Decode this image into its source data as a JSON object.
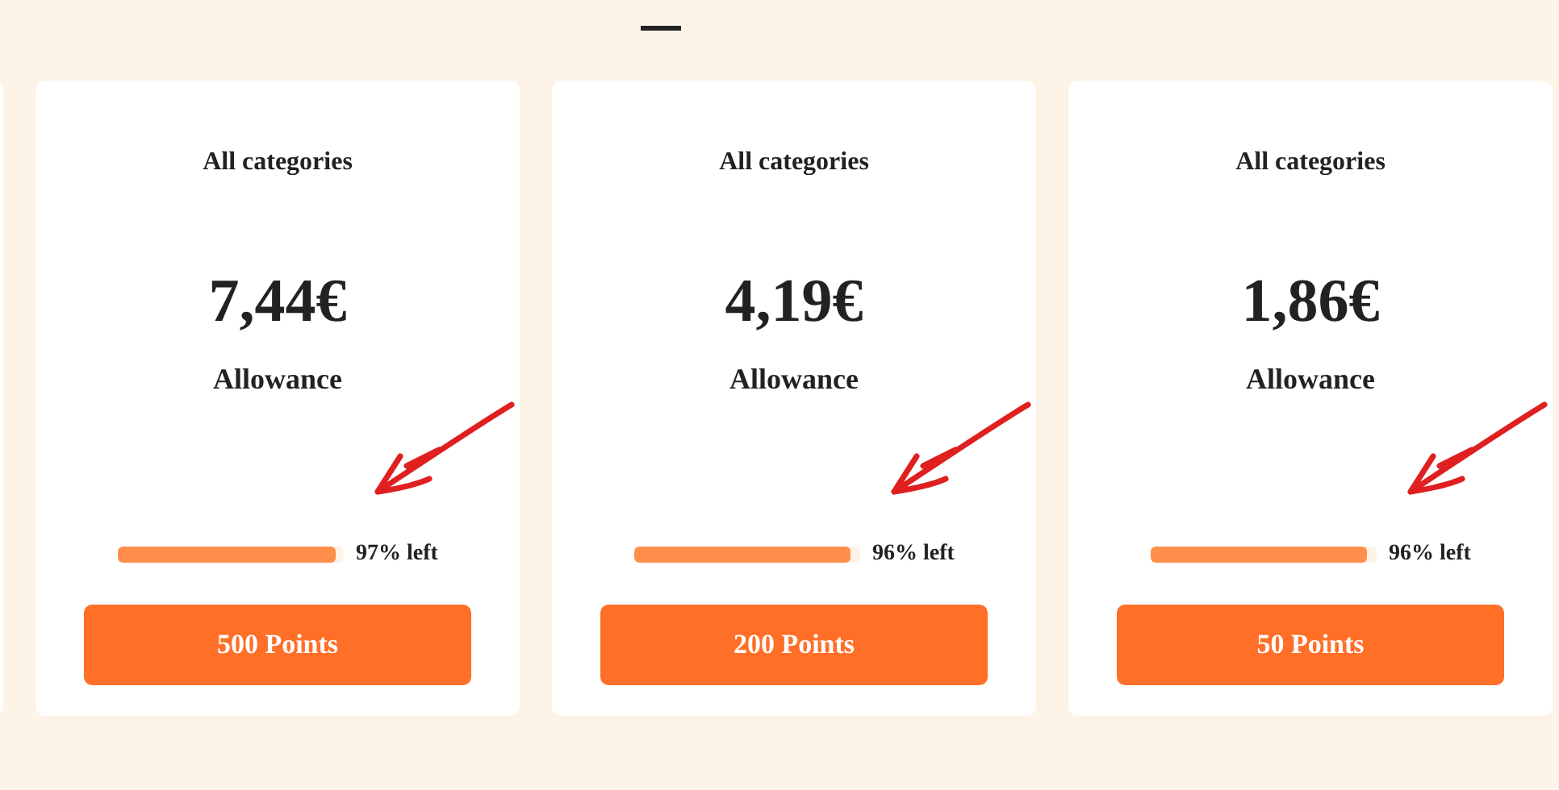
{
  "cards": [
    {
      "category": "All categories",
      "amount": "7,44€",
      "label": "Allowance",
      "level": 0.97,
      "remaining": "97% left",
      "button": "500 Points"
    },
    {
      "category": "All categories",
      "amount": "4,19€",
      "label": "Allowance",
      "level": 0.96,
      "remaining": "96% left",
      "button": "200 Points"
    },
    {
      "category": "All categories",
      "amount": "1,86€",
      "label": "Allowance",
      "level": 0.96,
      "remaining": "96% left",
      "button": "50 Points"
    }
  ]
}
